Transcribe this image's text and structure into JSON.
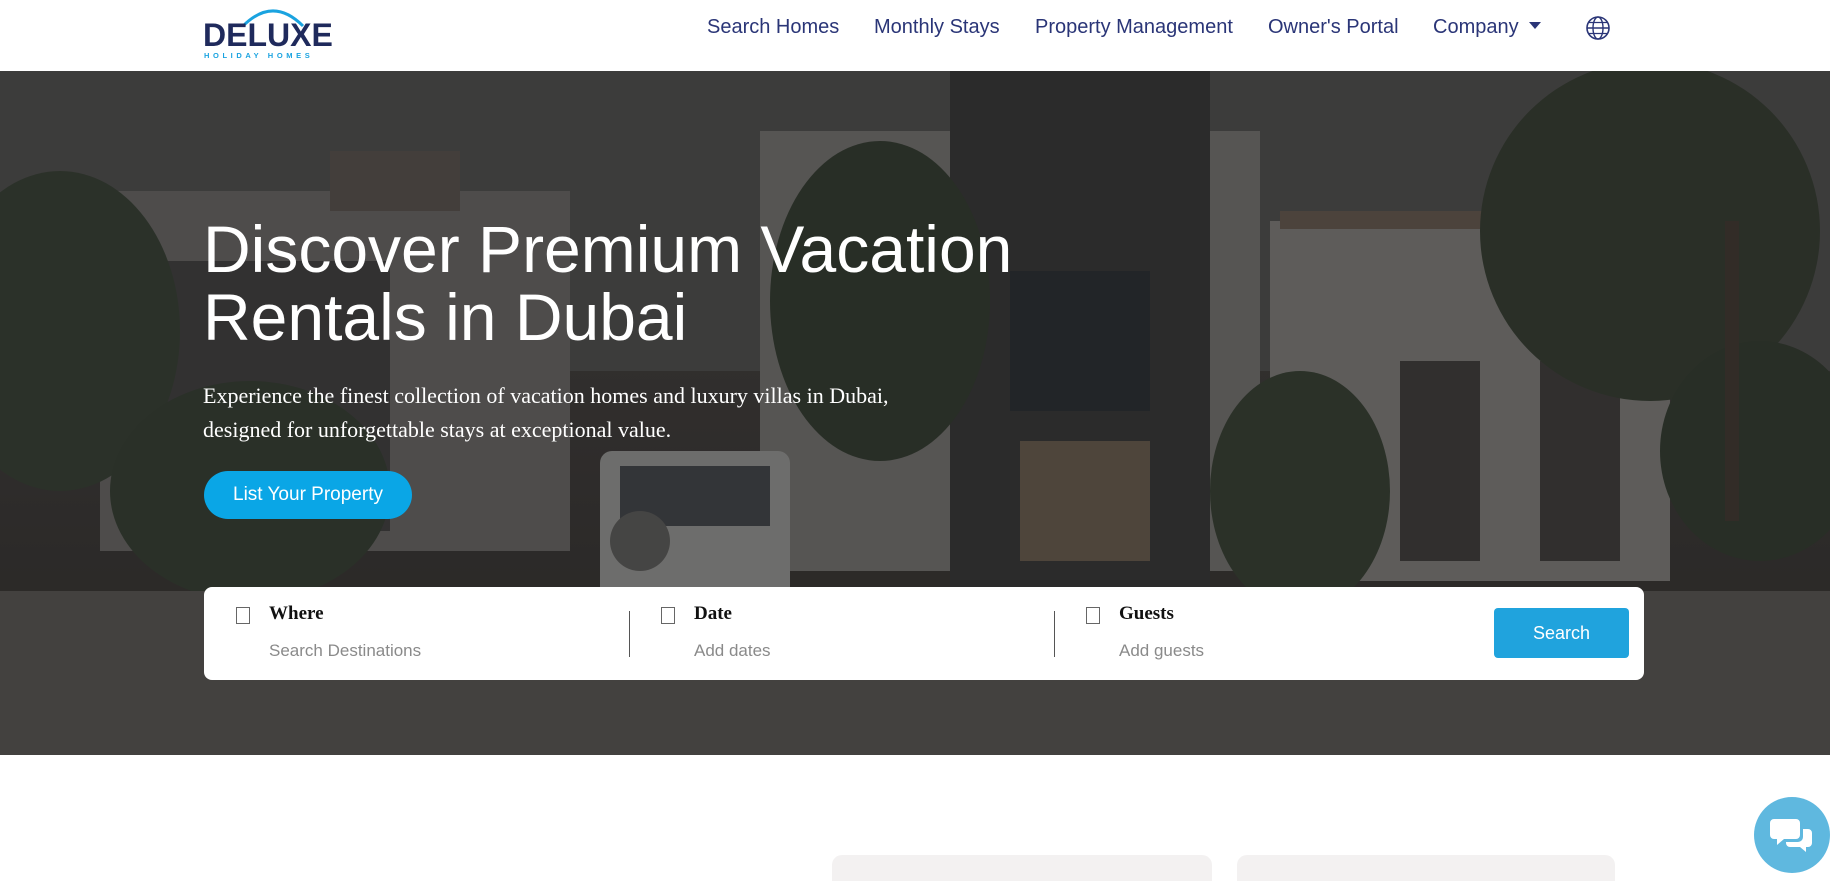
{
  "brand": {
    "name": "DELUXE",
    "tagline": "HOLIDAY HOMES"
  },
  "nav": {
    "items": [
      "Search Homes",
      "Monthly Stays",
      "Property Management",
      "Owner's Portal",
      "Company"
    ],
    "language_icon": "globe-icon"
  },
  "hero": {
    "title_line1": "Discover Premium Vacation",
    "title_line2": "Rentals in Dubai",
    "subtitle_line1": "Experience the finest collection of vacation homes and luxury villas in Dubai,",
    "subtitle_line2": "designed for unforgettable stays at exceptional value.",
    "cta_label": "List Your Property"
  },
  "search": {
    "where_label": "Where",
    "where_placeholder": "Search Destinations",
    "date_label": "Date",
    "date_placeholder": "Add dates",
    "guests_label": "Guests",
    "guests_placeholder": "Add guests",
    "button_label": "Search"
  },
  "chat": {
    "icon": "chat-bubbles-icon"
  },
  "colors": {
    "brand_navy": "#1f2a5c",
    "accent_blue": "#0aa6e6",
    "search_button": "#20a3dd",
    "chat": "#5fb8df"
  }
}
